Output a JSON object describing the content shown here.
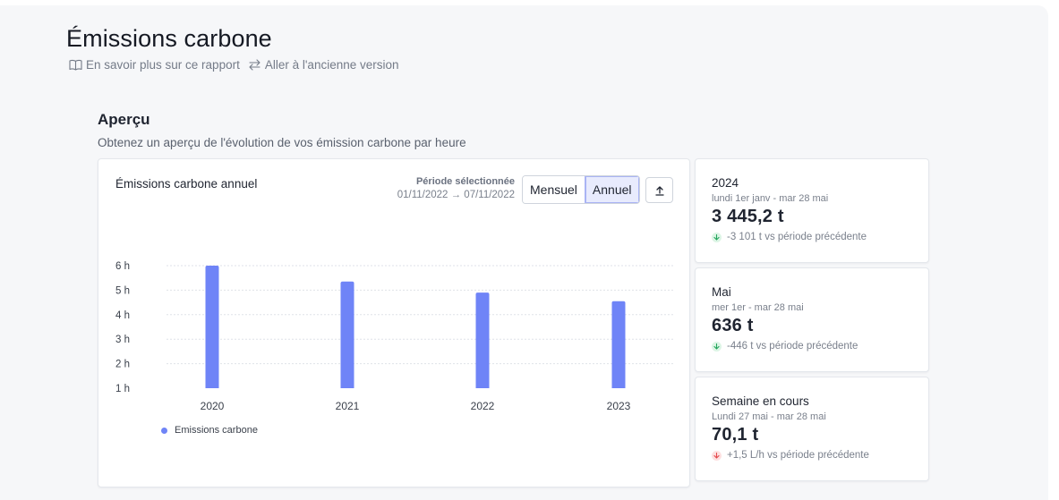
{
  "header": {
    "title": "Émissions carbone",
    "links": [
      {
        "label": "En savoir plus sur ce rapport",
        "icon": "book-icon"
      },
      {
        "label": "Aller à l'ancienne version",
        "icon": "swap-icon"
      }
    ]
  },
  "overview": {
    "title": "Aperçu",
    "subtitle": "Obtenez un aperçu de l'évolution de vos émission carbone par heure"
  },
  "chart_card": {
    "title": "Émissions carbone annuel",
    "period_label": "Période sélectionnée",
    "period_value": "01/11/2022 → 07/11/2022",
    "toggle": {
      "options": [
        "Mensuel",
        "Annuel"
      ],
      "selected": "Annuel"
    },
    "export_icon": "upload-icon"
  },
  "chart_data": {
    "type": "bar",
    "categories": [
      "2020",
      "2021",
      "2022",
      "2023"
    ],
    "series": [
      {
        "name": "Emissions carbone",
        "values": [
          6.0,
          5.35,
          4.9,
          4.55
        ],
        "color": "#6f84f7"
      }
    ],
    "y_ticks": [
      "6 h",
      "5 h",
      "4 h",
      "3 h",
      "2 h",
      "1 h"
    ],
    "ylim": [
      1,
      6
    ],
    "grid": true,
    "legend": "bottom-left"
  },
  "stats": [
    {
      "name": "2024",
      "range": "lundi 1er janv - mar 28 mai",
      "value": "3 445,2 t",
      "delta": "-3 101 t  vs période précédente",
      "trend": "down",
      "trend_color": "#22a55b"
    },
    {
      "name": "Mai",
      "range": "mer 1er - mar 28 mai",
      "value": "636 t",
      "delta": "-446 t  vs période précédente",
      "trend": "down",
      "trend_color": "#22a55b"
    },
    {
      "name": "Semaine en cours",
      "range": "Lundi 27 mai - mar 28 mai",
      "value": "70,1 t",
      "delta": "+1,5 L/h vs période précédente",
      "trend": "up",
      "trend_color": "#e5484d"
    }
  ]
}
